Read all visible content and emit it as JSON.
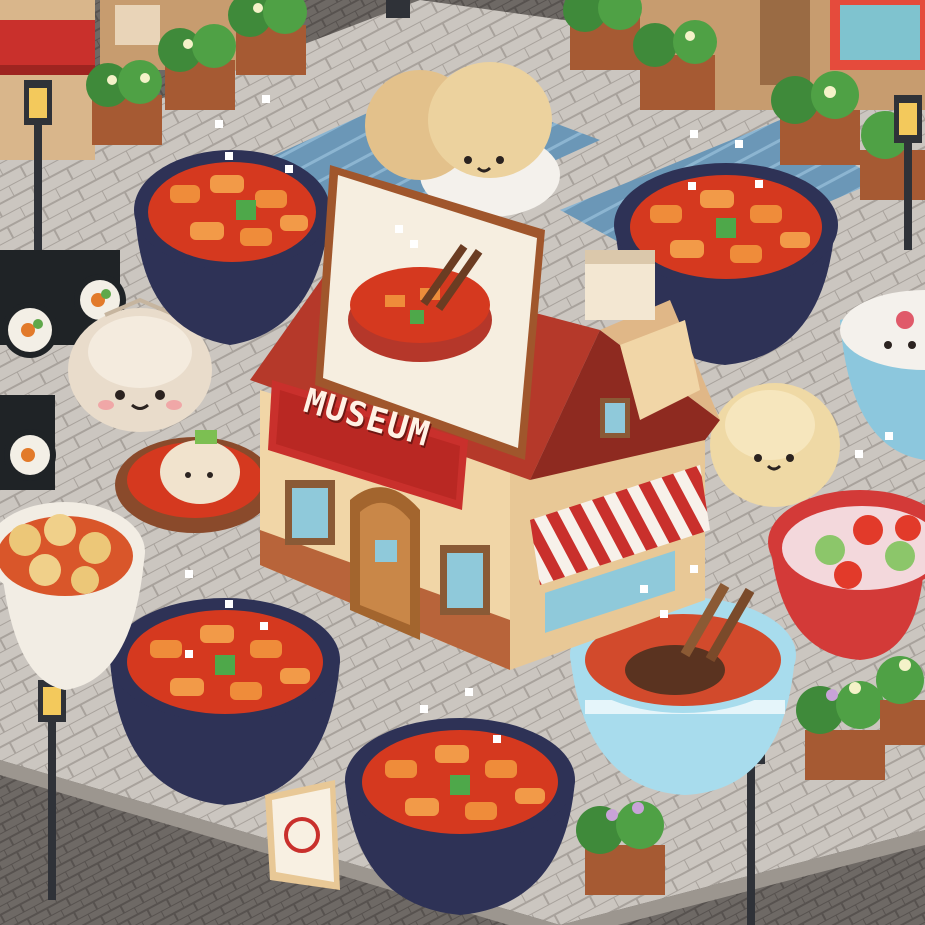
{
  "scene": {
    "type": "isometric pixel-art game map",
    "theme": "food museum plaza"
  },
  "museum": {
    "sign_text": "MUSEUM",
    "billboard_icon": "soup-bowl-chopsticks-icon"
  },
  "colors": {
    "plaza_tile": "#c8c3bd",
    "road": "#7d7773",
    "water": "#6f9ab8",
    "bowl_dark": "#2e3256",
    "stew_red": "#d5391f",
    "tteok_orange": "#ef8c3a",
    "museum_roof": "#b5392a",
    "museum_wall": "#f1d6a7",
    "awning_red": "#c9302c",
    "lamp_post": "#2f3238"
  }
}
